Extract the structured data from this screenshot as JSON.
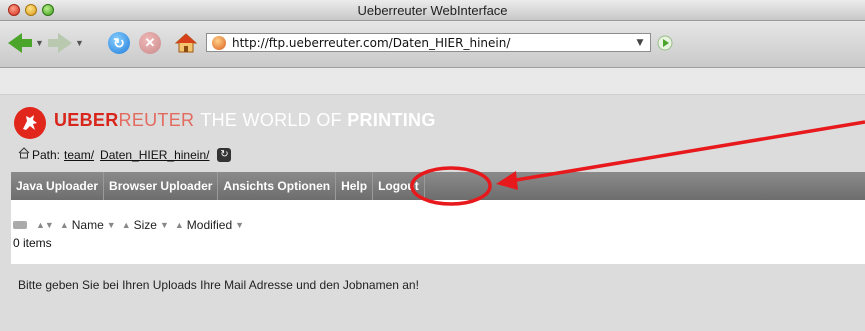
{
  "window": {
    "title": "Ueberreuter WebInterface"
  },
  "toolbar": {
    "back_icon": "back-arrow-icon",
    "forward_icon": "forward-arrow-icon",
    "reload_icon": "reload-icon",
    "stop_icon": "stop-icon",
    "home_icon": "home-icon",
    "url": "http://ftp.ueberreuter.com/Daten_HIER_hinein/",
    "go_icon": "go-arrow-icon"
  },
  "brand": {
    "part1": "UEBER",
    "part2": "REUTER",
    "part3": "THE WORLD OF",
    "part4": "PRINTING"
  },
  "path": {
    "label": "Path:",
    "crumbs": [
      "team/",
      "Daten_HIER_hinein/"
    ]
  },
  "nav": {
    "items": [
      "Java Uploader",
      "Browser Uploader",
      "Ansichts Optionen",
      "Help",
      "Logout"
    ]
  },
  "files": {
    "columns": [
      "Name",
      "Size",
      "Modified"
    ],
    "count": "0 items"
  },
  "notice": "Bitte geben Sie bei Ihren Uploads Ihre Mail Adresse und den Jobnamen an!",
  "colors": {
    "brand_red": "#d8261c",
    "annotation_red": "#e8191c",
    "nav_bar": "#7a7a7a"
  }
}
